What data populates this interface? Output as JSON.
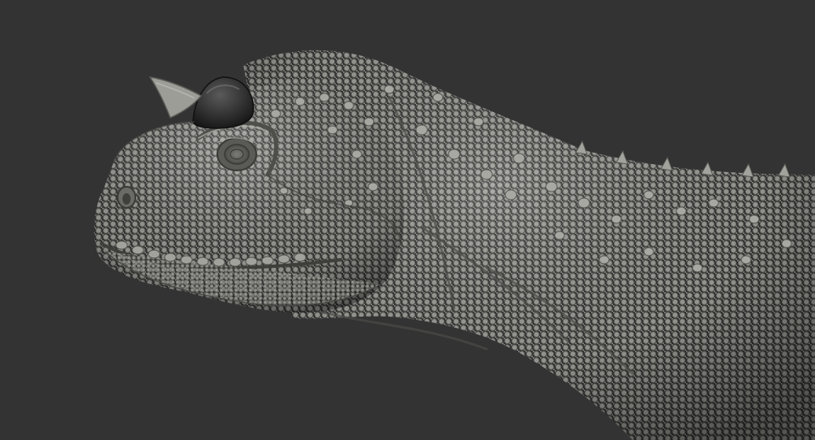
{
  "scene": {
    "background_color": "#333333",
    "subject": "sculpted-dinosaur-head-and-neck",
    "skin_color": "#8a8a85",
    "skin_shadow_color": "#4f4f4c",
    "skin_highlight_color": "#b3b3ad",
    "horn_color": "#1f1f1f",
    "horn_highlight_color": "#5a5a5a",
    "eye_color": "#6e6e69"
  }
}
